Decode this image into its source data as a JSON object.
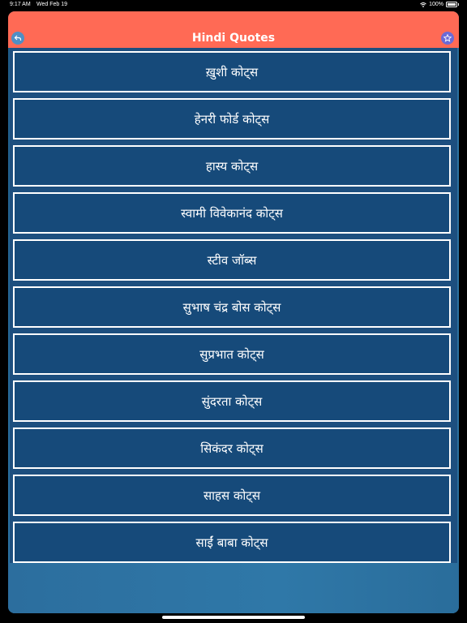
{
  "status_bar": {
    "time": "9:17 AM",
    "date": "Wed Feb 19",
    "battery": "100%"
  },
  "header": {
    "title": "Hindi Quotes",
    "back_icon": "back-arrow-icon",
    "fav_icon": "star-icon",
    "color": "#ff6a55"
  },
  "list": {
    "items": [
      "ख़ुशी कोट्स",
      "हेनरी फोर्ड कोट्स",
      "हास्य कोट्स",
      "स्वामी विवेकानंद कोट्स",
      "स्टीव जॉब्स",
      "सुभाष चंद्र बोस कोट्स",
      "सुप्रभात कोट्स",
      "सुंदरता कोट्स",
      "सिकंदर कोट्स",
      "साहस कोट्स",
      "साईं बाबा कोट्स"
    ]
  }
}
